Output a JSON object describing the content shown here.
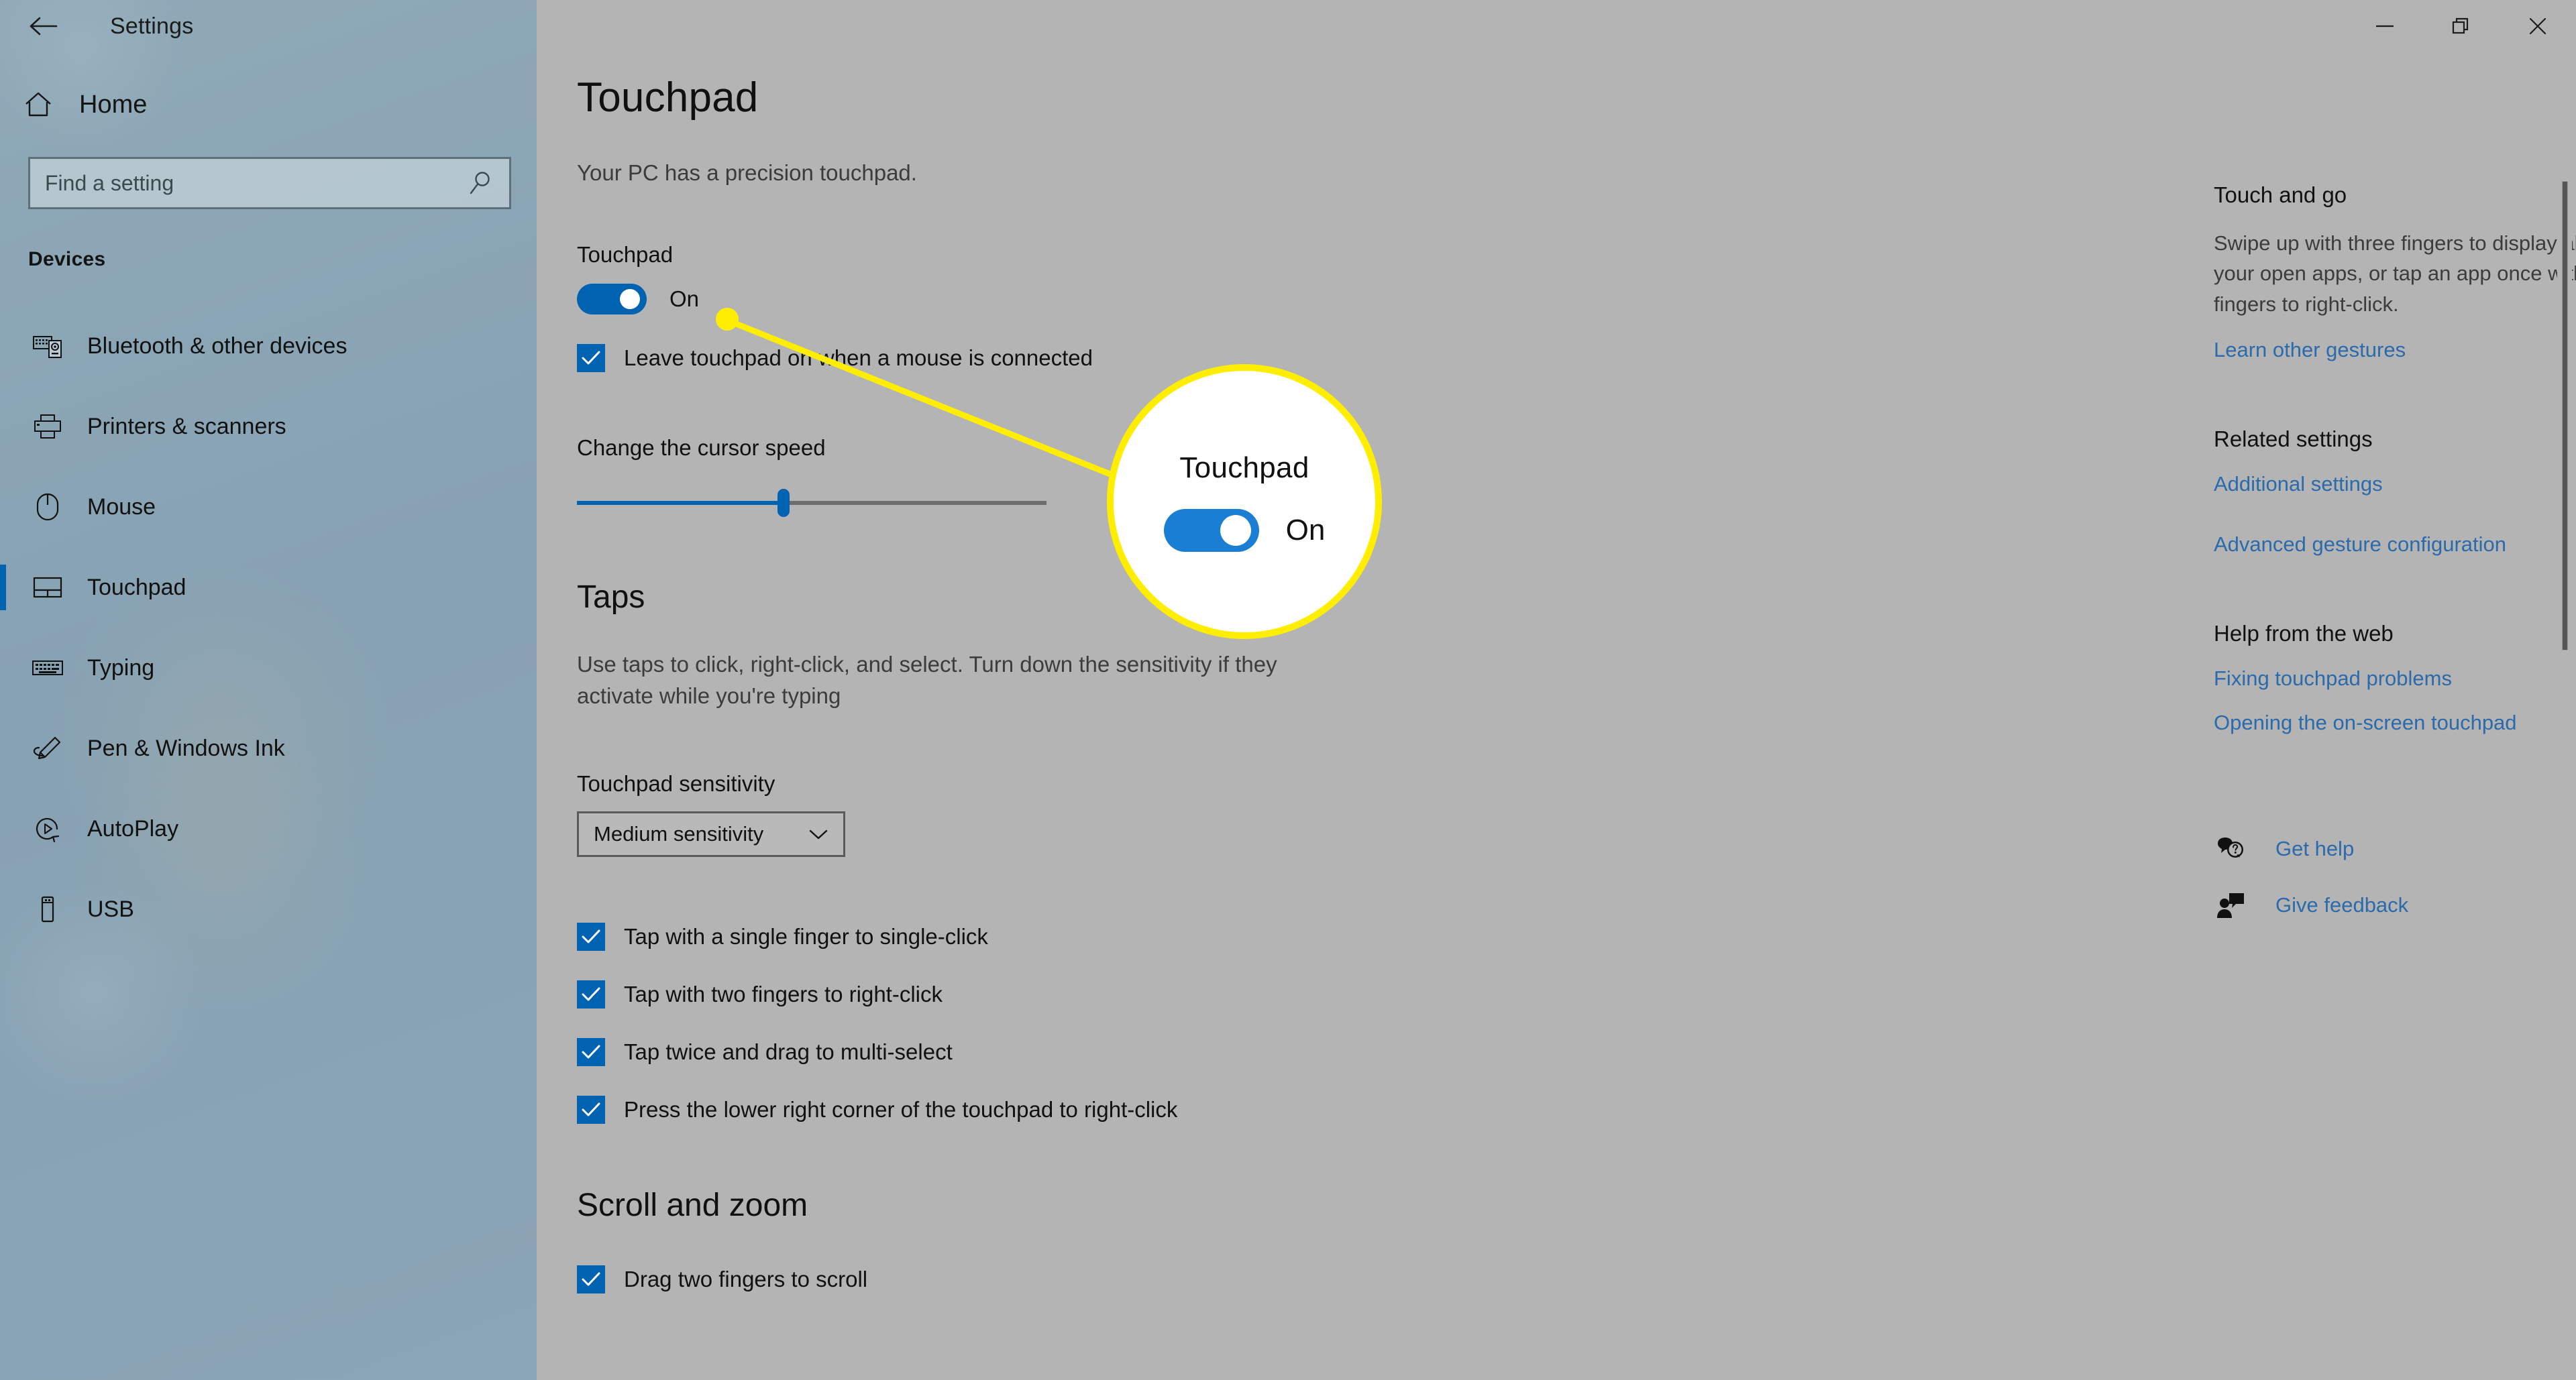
{
  "window": {
    "controls": [
      {
        "name": "minimize",
        "glyph": "minimize-icon"
      },
      {
        "name": "restore",
        "glyph": "restore-icon"
      },
      {
        "name": "close",
        "glyph": "close-icon"
      }
    ]
  },
  "sidebar": {
    "back_label": "back-arrow-icon",
    "title": "Settings",
    "home": {
      "icon": "home-icon",
      "label": "Home"
    },
    "search": {
      "placeholder": "Find a setting",
      "value": "",
      "icon": "search-icon"
    },
    "group_title": "Devices",
    "items": [
      {
        "label": "Bluetooth & other devices",
        "icon": "bluetooth-devices-icon",
        "selected": false
      },
      {
        "label": "Printers & scanners",
        "icon": "printer-icon",
        "selected": false
      },
      {
        "label": "Mouse",
        "icon": "mouse-icon",
        "selected": false
      },
      {
        "label": "Touchpad",
        "icon": "touchpad-icon",
        "selected": true
      },
      {
        "label": "Typing",
        "icon": "keyboard-icon",
        "selected": false
      },
      {
        "label": "Pen & Windows Ink",
        "icon": "pen-icon",
        "selected": false
      },
      {
        "label": "AutoPlay",
        "icon": "autoplay-icon",
        "selected": false
      },
      {
        "label": "USB",
        "icon": "usb-icon",
        "selected": false
      }
    ]
  },
  "main": {
    "page_title": "Touchpad",
    "subtitle": "Your PC has a precision touchpad.",
    "touchpad_toggle": {
      "label": "Touchpad",
      "state": "On",
      "on": true
    },
    "leave_on_checkbox": {
      "label": "Leave touchpad on when a mouse is connected",
      "checked": true
    },
    "cursor_speed": {
      "label": "Change the cursor speed",
      "value_percent": 44
    },
    "taps": {
      "heading": "Taps",
      "description": "Use taps to click, right-click, and select. Turn down the sensitivity if they activate while you're typing",
      "sensitivity_label": "Touchpad sensitivity",
      "sensitivity_value": "Medium sensitivity",
      "checkboxes": [
        {
          "label": "Tap with a single finger to single-click",
          "checked": true
        },
        {
          "label": "Tap with two fingers to right-click",
          "checked": true
        },
        {
          "label": "Tap twice and drag to multi-select",
          "checked": true
        },
        {
          "label": "Press the lower right corner of the touchpad to right-click",
          "checked": true
        }
      ]
    },
    "scroll_zoom": {
      "heading": "Scroll and zoom",
      "checkboxes": [
        {
          "label": "Drag two fingers to scroll",
          "checked": true
        }
      ]
    }
  },
  "right_panel": {
    "touch_and_go": {
      "heading": "Touch and go",
      "body": "Swipe up with three fingers to display all your open apps, or tap an app once with two fingers to right-click.",
      "link": "Learn other gestures"
    },
    "related_settings": {
      "heading": "Related settings",
      "links": [
        "Additional settings",
        "Advanced gesture configuration"
      ]
    },
    "help_from_web": {
      "heading": "Help from the web",
      "links": [
        "Fixing touchpad problems",
        "Opening the on-screen touchpad"
      ]
    },
    "support_links": [
      {
        "label": "Get help",
        "icon": "help-bubble-icon"
      },
      {
        "label": "Give feedback",
        "icon": "feedback-person-icon"
      }
    ]
  },
  "annotation": {
    "color": "#ffee00",
    "magnifier": {
      "title": "Touchpad",
      "toggle_state": "On"
    }
  },
  "colors": {
    "accent": "#0063b1",
    "sidebar_bg": "#8ba8b8",
    "content_bg": "#b4b4b4",
    "link": "#2b6aab",
    "annotation": "#ffee00"
  }
}
